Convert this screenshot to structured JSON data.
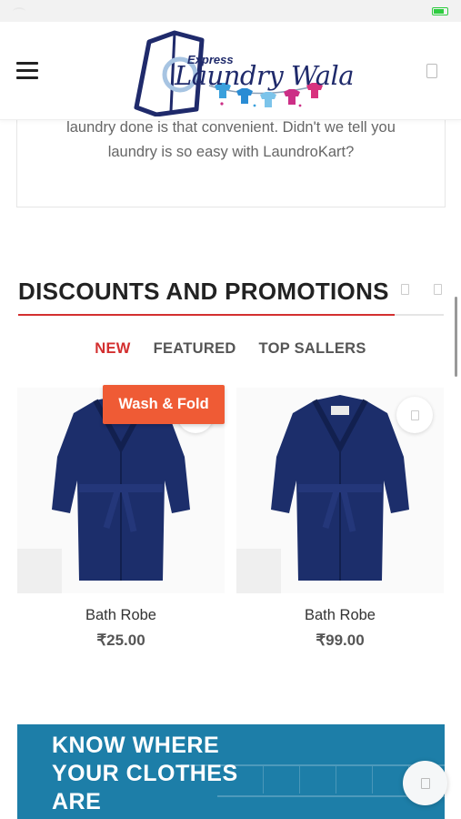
{
  "status_bar": {
    "carrier": "",
    "time": ""
  },
  "header": {
    "logo": {
      "express": "Express",
      "name": "Laundry Wala"
    },
    "colors": {
      "logo_navy": "#1f2a6b"
    }
  },
  "about": {
    "text_line1": "laundry done is that convenient. Didn't we tell you",
    "text_line2": "laundry is so easy with LaundroKart?"
  },
  "promotions": {
    "title": "DISCOUNTS AND PROMOTIONS",
    "tabs": [
      {
        "label": "NEW",
        "active": true
      },
      {
        "label": "FEATURED",
        "active": false
      },
      {
        "label": "TOP SALLERS",
        "active": false
      }
    ],
    "badge": "Wash & Fold",
    "products": [
      {
        "name": "Bath Robe",
        "price": "₹25.00"
      },
      {
        "name": "Bath Robe",
        "price": "₹99.00"
      }
    ],
    "colors": {
      "accent": "#d32f2f",
      "badge": "#ef5b35",
      "robe": "#1c2e6b"
    }
  },
  "banner": {
    "line1": "KNOW WHERE",
    "line2": "YOUR CLOTHES",
    "line3": "ARE",
    "color": "#1d7ea8"
  }
}
